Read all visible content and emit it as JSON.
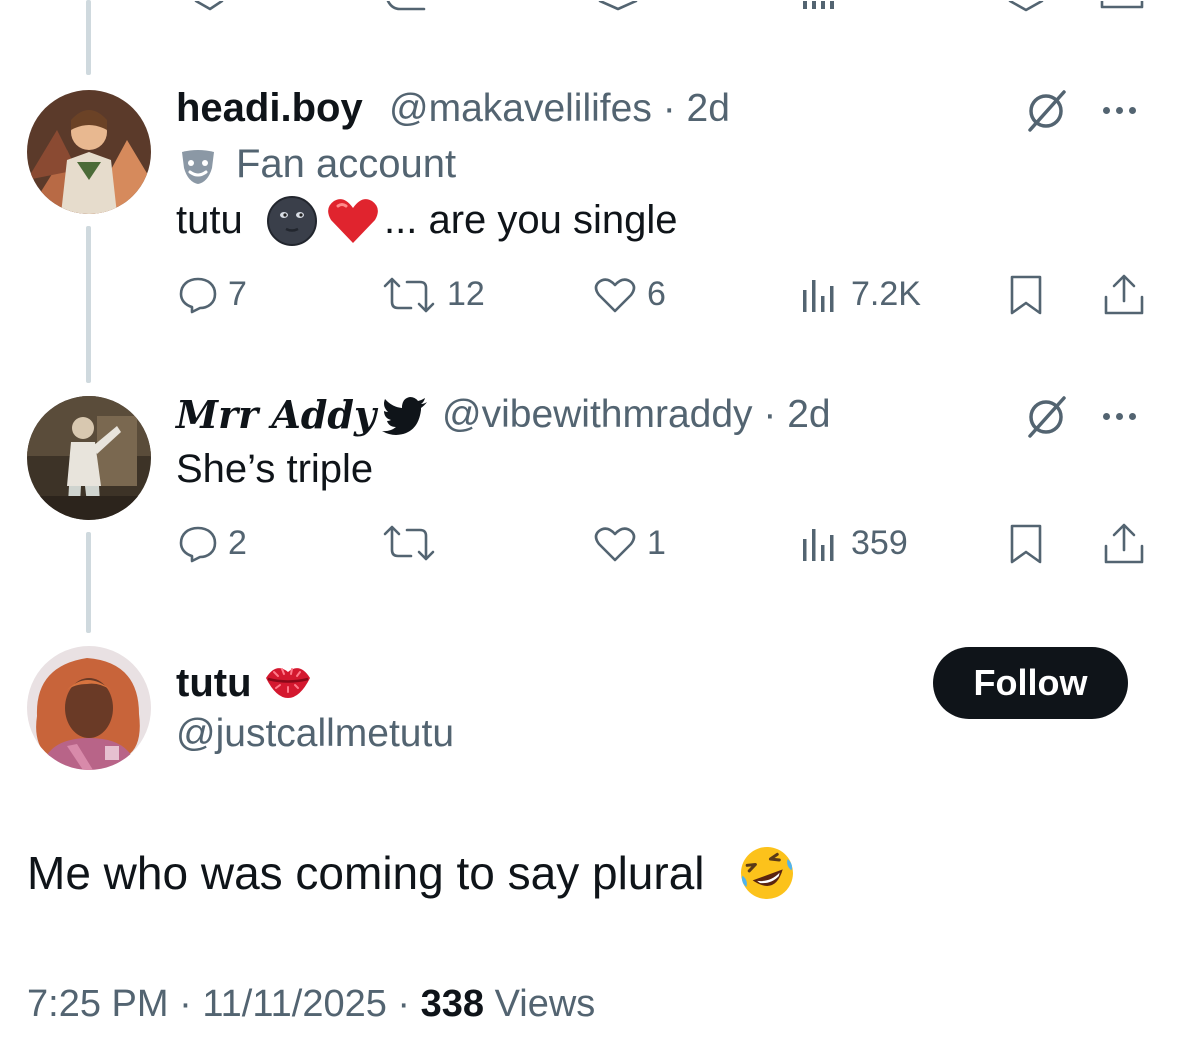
{
  "reply1": {
    "name": "headi.boy",
    "handle": "@makavelilifes",
    "dot": "·",
    "time": "2d",
    "badge_label": "Fan account",
    "text_before": "tutu",
    "text_after": "... are you single",
    "emojis": [
      "new-moon-face",
      "red-heart"
    ],
    "counts": {
      "replies": "7",
      "reposts": "12",
      "likes": "6",
      "views": "7.2K"
    }
  },
  "reply2": {
    "name": "Mrr Addy",
    "handle": "@vibewithmraddy",
    "dot": "·",
    "time": "2d",
    "text": "She’s triple",
    "counts": {
      "replies": "2",
      "reposts": "",
      "likes": "1",
      "views": "359"
    }
  },
  "main_post": {
    "name": "tutu",
    "name_emoji": "kiss-mark",
    "handle": "@justcallmetutu",
    "follow_label": "Follow",
    "text": "Me who was coming to say plural",
    "text_emoji": "rolling-on-floor-laughing",
    "time": "7:25 PM",
    "sep": "·",
    "date": "11/11/2025",
    "views_count": "338",
    "views_label": "Views"
  },
  "colors": {
    "text_primary": "#0f1419",
    "text_secondary": "#536471",
    "thread_line": "#cfd9de",
    "follow_bg": "#0f1419",
    "follow_text": "#ffffff",
    "heart": "#e0245e",
    "twitter_bird": "#0f1419"
  }
}
